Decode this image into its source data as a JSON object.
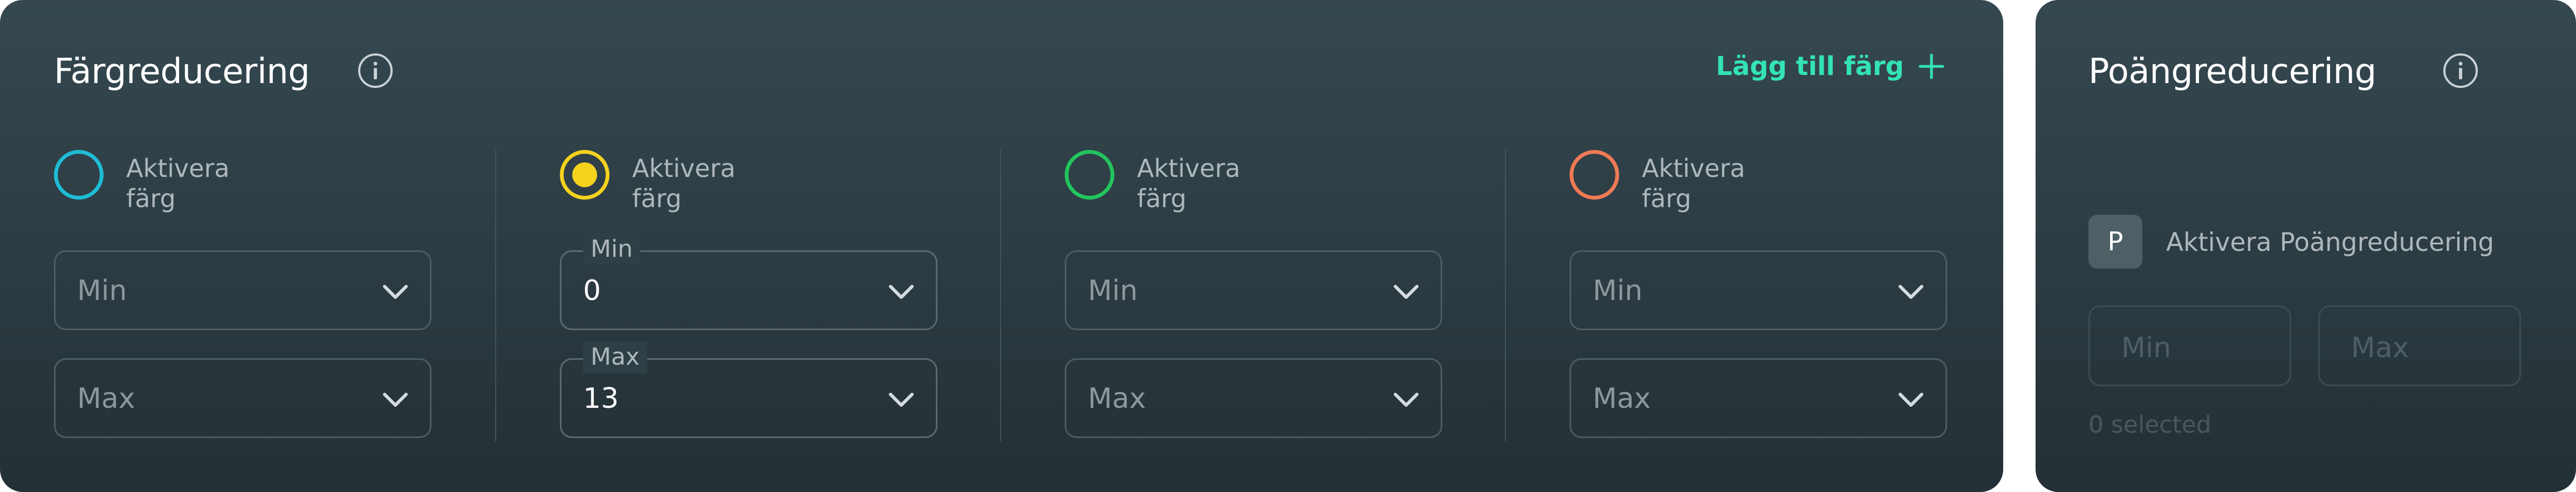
{
  "color_reduction": {
    "title": "Färgreducering",
    "info_icon": "info-circle-icon",
    "add_label": "Lägg till färg",
    "add_icon": "plus-icon",
    "chevron_icon": "chevron-down-icon",
    "columns": [
      {
        "color": "#1fbcd6",
        "selected": false,
        "toggle_label": "Aktivera färg",
        "min": {
          "label": "Min",
          "value": ""
        },
        "max": {
          "label": "Max",
          "value": ""
        }
      },
      {
        "color": "#f5d21e",
        "selected": true,
        "toggle_label": "Aktivera färg",
        "min": {
          "label": "Min",
          "value": "0"
        },
        "max": {
          "label": "Max",
          "value": "13"
        }
      },
      {
        "color": "#22c55e",
        "selected": false,
        "toggle_label": "Aktivera färg",
        "min": {
          "label": "Min",
          "value": ""
        },
        "max": {
          "label": "Max",
          "value": ""
        }
      },
      {
        "color": "#f07a55",
        "selected": false,
        "toggle_label": "Aktivera färg",
        "min": {
          "label": "Min",
          "value": ""
        },
        "max": {
          "label": "Max",
          "value": ""
        }
      }
    ]
  },
  "point_reduction": {
    "title": "Poängreducering",
    "info_icon": "info-circle-icon",
    "badge": "P",
    "enable_label": "Aktivera Poängreducering",
    "min_placeholder": "Min",
    "max_placeholder": "Max",
    "selected_text": "0  selected"
  },
  "colors": {
    "accent": "#33e3b6",
    "panel_bg": "#2f3f46"
  }
}
